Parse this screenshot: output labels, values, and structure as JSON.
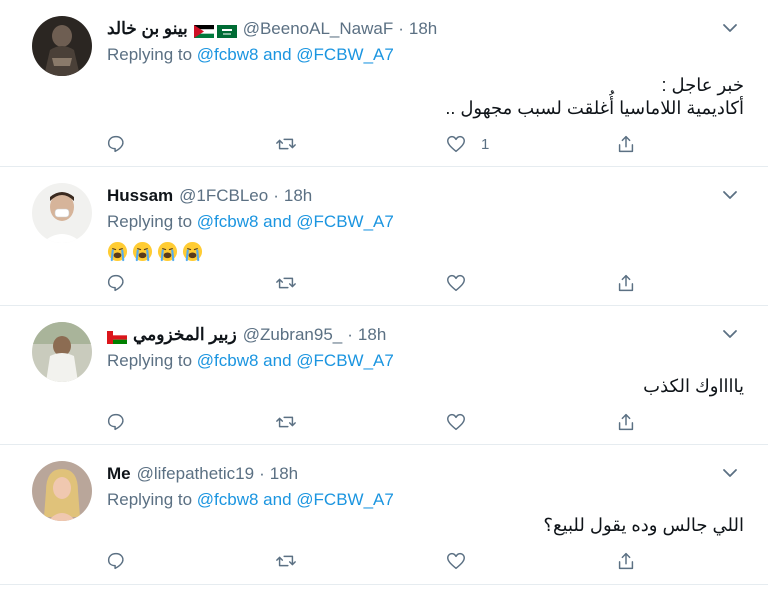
{
  "tweets": [
    {
      "name": "بينو بن خالد",
      "handle": "@BeenoAL_NawaF",
      "time": "18h",
      "reply_prefix": "Replying to",
      "reply_users": "@fcbw8 and @FCBW_A7",
      "text_lines": [
        "خبر عاجل :",
        "أكاديمية اللاماسيا أُغلقت لسبب مجهول .."
      ],
      "like_count": "1",
      "flags": [
        "jordan",
        "saudi"
      ]
    },
    {
      "name": "Hussam",
      "handle": "@1FCBLeo",
      "time": "18h",
      "reply_prefix": "Replying to",
      "reply_users": "@fcbw8 and @FCBW_A7",
      "emoji": [
        "crying-face",
        "crying-face",
        "crying-face",
        "crying-face"
      ]
    },
    {
      "name": "زبير المخزومي",
      "handle": "@Zubran95_",
      "time": "18h",
      "reply_prefix": "Replying to",
      "reply_users": "@fcbw8 and @FCBW_A7",
      "text_lines": [
        "يااااوك الكذب"
      ],
      "flags": [
        "oman"
      ]
    },
    {
      "name": "Me",
      "handle": "@lifepathetic19",
      "time": "18h",
      "reply_prefix": "Replying to",
      "reply_users": "@fcbw8 and @FCBW_A7",
      "text_lines": [
        "اللي جالس وده يقول للبيع؟"
      ]
    }
  ],
  "colors": {
    "link": "#1b95e0",
    "muted": "#5b7083",
    "divider": "#e6ecf0"
  }
}
